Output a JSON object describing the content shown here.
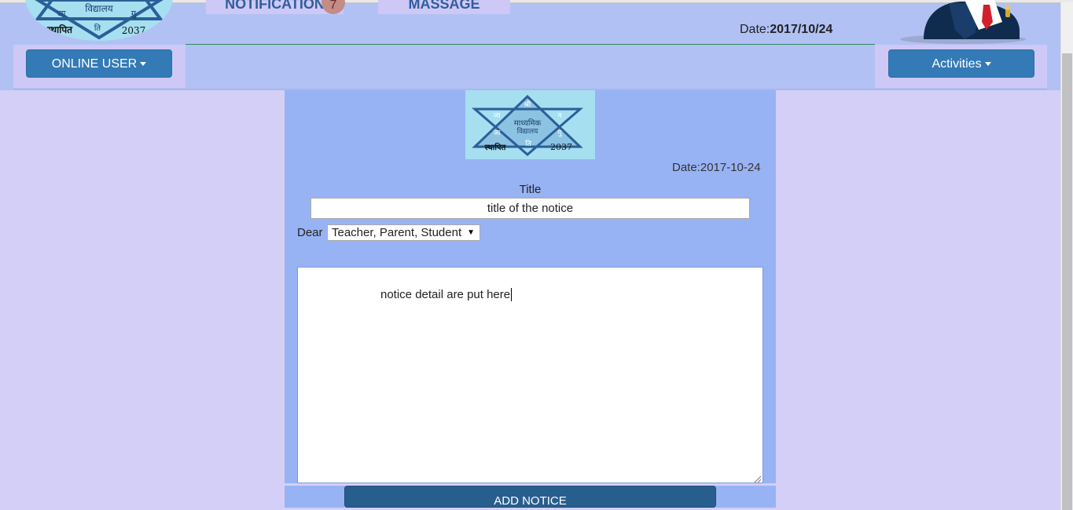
{
  "header": {
    "nav_notification": "NOTIFICATION",
    "notification_count": "7",
    "nav_massage": "MASSAGE",
    "date_label": "Date:",
    "date_value": "2017/10/24",
    "online_user_label": "ONLINE USER",
    "activities_label": "Activities"
  },
  "school_logo": {
    "word_school": "विद्यालय",
    "word_secondary": "माध्यमिक",
    "word_established": "स्थापित",
    "year": "2037",
    "letter_ja": "जा",
    "letter_gu": "गु",
    "letter_ti": "ति",
    "letter_shree": "श्री",
    "letter_na": "न"
  },
  "notice_form": {
    "date": "Date:2017-10-24",
    "title_label": "Title",
    "title_value": "title of the notice",
    "dear_label": "Dear",
    "recipient_selected": "Teacher, Parent, Student",
    "detail_text": "notice detail are put here",
    "submit_label": "ADD NOTICE"
  },
  "colors": {
    "page_background": "#d4cff7",
    "header_background": "#b2c1f4",
    "panel_background": "#98b3f4",
    "primary_button": "#337ab7",
    "submit_button": "#285e8e",
    "logo_background": "#a6dff0"
  },
  "icons": [
    "caret-down-icon",
    "school-logo",
    "user-avatar",
    "select-arrow-icon",
    "resize-grip-icon"
  ]
}
